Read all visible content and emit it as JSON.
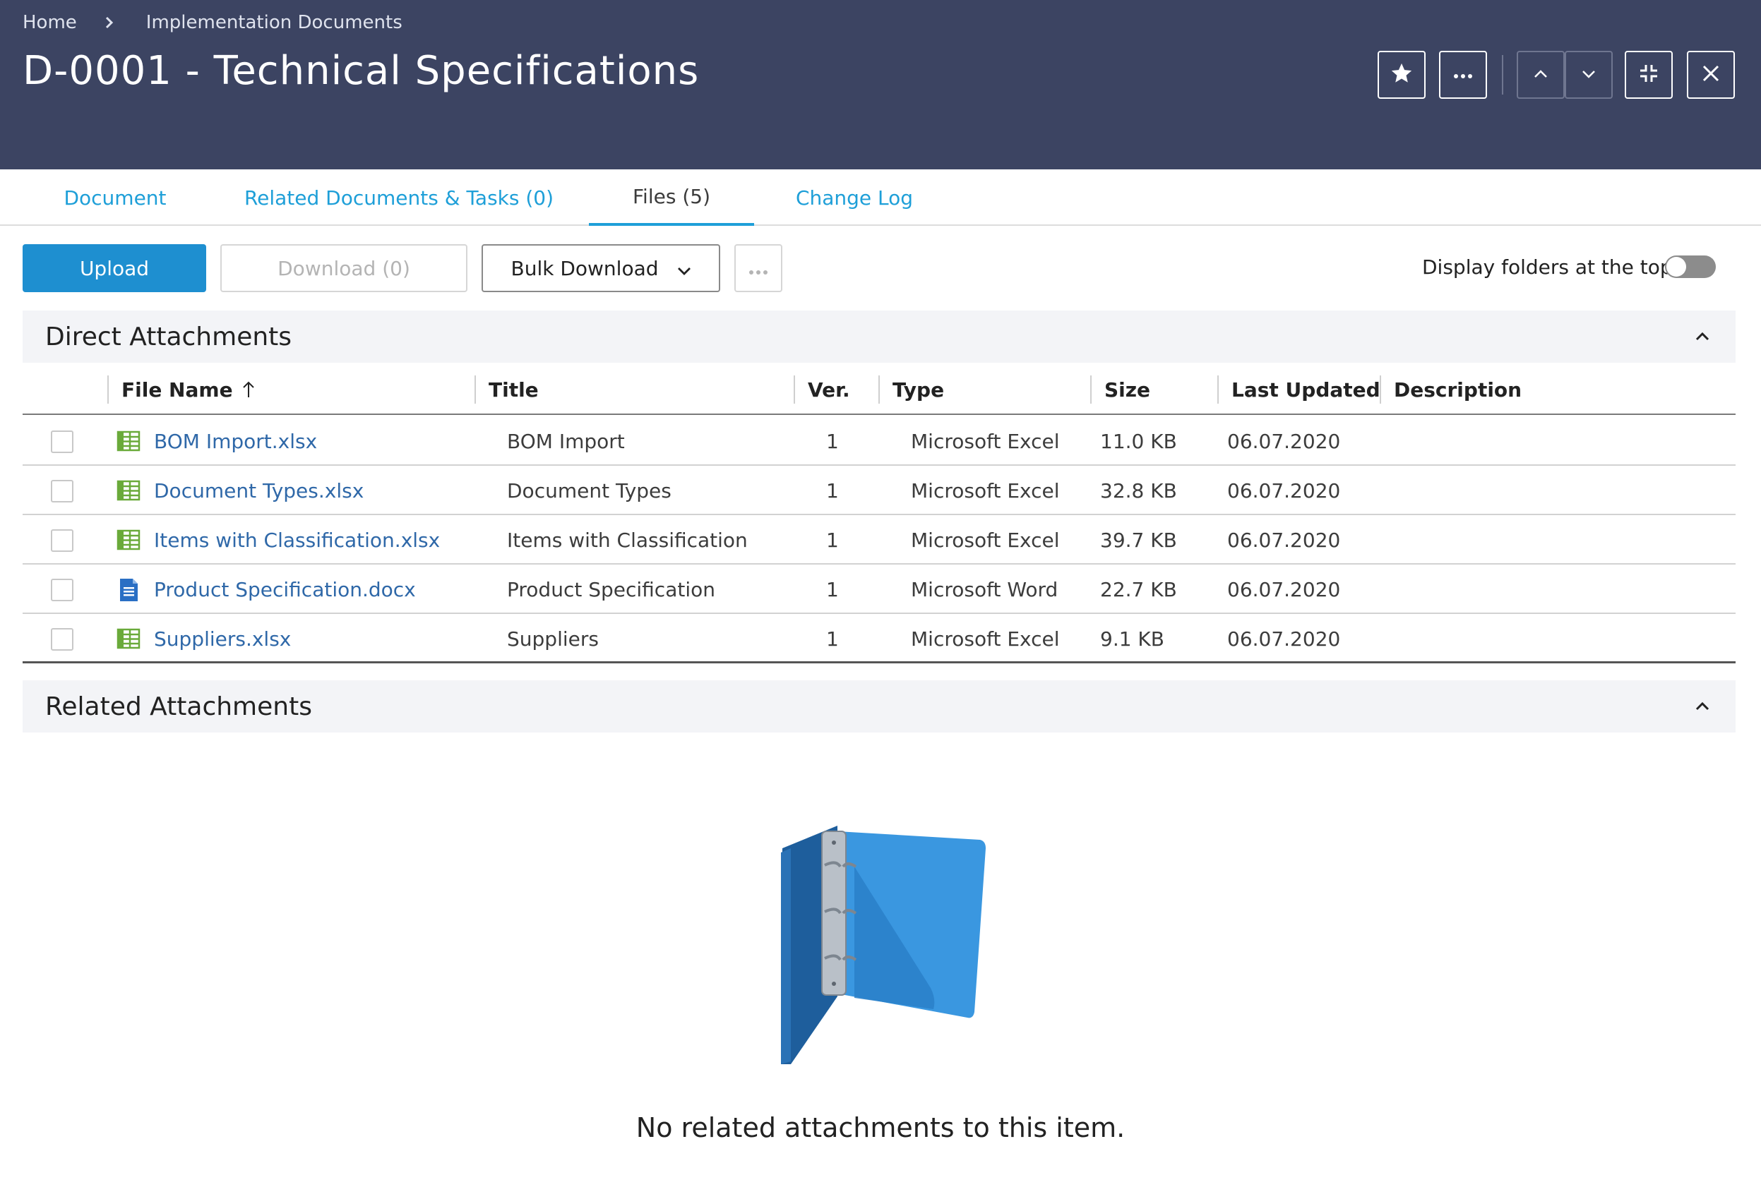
{
  "breadcrumb": {
    "home": "Home",
    "current": "Implementation Documents"
  },
  "page": {
    "title": "D-0001 - Technical Specifications"
  },
  "header_actions": {
    "favorite_icon": "star-icon",
    "more_icon": "ellipsis-icon",
    "prev_icon": "chevron-up-icon",
    "next_icon": "chevron-down-icon",
    "collapse_icon": "compress-icon",
    "close_icon": "close-icon"
  },
  "tabs": [
    {
      "label": "Document",
      "active": false
    },
    {
      "label": "Related Documents & Tasks (0)",
      "active": false
    },
    {
      "label": "Files (5)",
      "active": true
    },
    {
      "label": "Change Log",
      "active": false
    }
  ],
  "toolbar": {
    "upload_label": "Upload",
    "download_label": "Download (0)",
    "bulk_download_label": "Bulk Download",
    "toggle_label": "Display folders at the top",
    "toggle_on": false
  },
  "direct": {
    "title": "Direct Attachments",
    "columns": [
      "File Name",
      "Title",
      "Ver.",
      "Type",
      "Size",
      "Last Updated",
      "Description"
    ],
    "rows": [
      {
        "icon": "excel-file-icon",
        "file_name": "BOM Import.xlsx",
        "title": "BOM Import",
        "ver": "1",
        "type": "Microsoft Excel",
        "size": "11.0 KB",
        "updated": "06.07.2020",
        "description": ""
      },
      {
        "icon": "excel-file-icon",
        "file_name": "Document Types.xlsx",
        "title": "Document Types",
        "ver": "1",
        "type": "Microsoft Excel",
        "size": "32.8 KB",
        "updated": "06.07.2020",
        "description": ""
      },
      {
        "icon": "excel-file-icon",
        "file_name": "Items with Classification.xlsx",
        "title": "Items with Classification",
        "ver": "1",
        "type": "Microsoft Excel",
        "size": "39.7 KB",
        "updated": "06.07.2020",
        "description": ""
      },
      {
        "icon": "word-file-icon",
        "file_name": "Product Specification.docx",
        "title": "Product Specification",
        "ver": "1",
        "type": "Microsoft Word",
        "size": "22.7 KB",
        "updated": "06.07.2020",
        "description": ""
      },
      {
        "icon": "excel-file-icon",
        "file_name": "Suppliers.xlsx",
        "title": "Suppliers",
        "ver": "1",
        "type": "Microsoft Excel",
        "size": "9.1 KB",
        "updated": "06.07.2020",
        "description": ""
      }
    ]
  },
  "related": {
    "title": "Related Attachments",
    "empty_message": "No related attachments to this item."
  },
  "colors": {
    "header_bg": "#3c4462",
    "accent": "#1e8fd0",
    "link": "#2f68a8",
    "excel": "#6aaa3a",
    "word": "#2a6fc4"
  }
}
